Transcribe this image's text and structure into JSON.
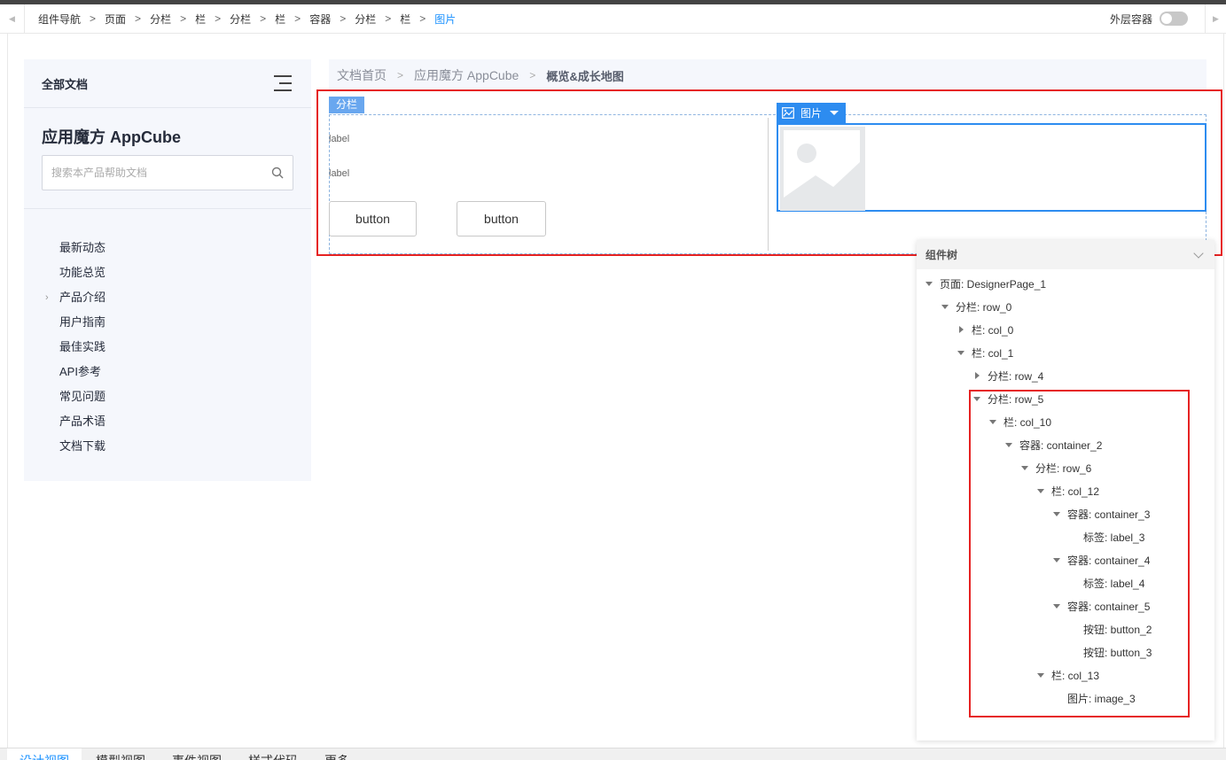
{
  "breadcrumb": {
    "items": [
      "组件导航",
      "页面",
      "分栏",
      "栏",
      "分栏",
      "栏",
      "容器",
      "分栏",
      "栏",
      "图片"
    ],
    "separator": ">"
  },
  "outer_container": {
    "label": "外层容器",
    "enabled": false
  },
  "doc_sidebar": {
    "header": "全部文档",
    "product_title": "应用魔方 AppCube",
    "search_placeholder": "搜索本产品帮助文档",
    "nav": [
      {
        "label": "最新动态",
        "expandable": false
      },
      {
        "label": "功能总览",
        "expandable": false
      },
      {
        "label": "产品介绍",
        "expandable": true
      },
      {
        "label": "用户指南",
        "expandable": false
      },
      {
        "label": "最佳实践",
        "expandable": false
      },
      {
        "label": "API参考",
        "expandable": false
      },
      {
        "label": "常见问题",
        "expandable": false
      },
      {
        "label": "产品术语",
        "expandable": false
      },
      {
        "label": "文档下载",
        "expandable": false
      }
    ]
  },
  "doc_breadcrumb": {
    "home": "文档首页",
    "product": "应用魔方 AppCube",
    "current": "概览&成长地图",
    "separator": ">"
  },
  "canvas": {
    "row_tag": "分栏",
    "label_1": "label",
    "label_2": "label",
    "button_1": "button",
    "button_2": "button",
    "image_tag": "图片"
  },
  "component_tree": {
    "title": "组件树",
    "nodes": [
      {
        "text": "页面: DesignerPage_1",
        "level": 0,
        "state": "expanded"
      },
      {
        "text": "分栏: row_0",
        "level": 1,
        "state": "expanded"
      },
      {
        "text": "栏: col_0",
        "level": 2,
        "state": "collapsed"
      },
      {
        "text": "栏: col_1",
        "level": 2,
        "state": "expanded"
      },
      {
        "text": "分栏: row_4",
        "level": 3,
        "state": "collapsed"
      },
      {
        "text": "分栏: row_5",
        "level": 3,
        "state": "expanded"
      },
      {
        "text": "栏: col_10",
        "level": 4,
        "state": "expanded"
      },
      {
        "text": "容器: container_2",
        "level": 5,
        "state": "expanded"
      },
      {
        "text": "分栏: row_6",
        "level": 6,
        "state": "expanded"
      },
      {
        "text": "栏: col_12",
        "level": 7,
        "state": "expanded"
      },
      {
        "text": "容器: container_3",
        "level": 8,
        "state": "expanded"
      },
      {
        "text": "标签: label_3",
        "level": 9,
        "state": "leaf"
      },
      {
        "text": "容器: container_4",
        "level": 8,
        "state": "expanded"
      },
      {
        "text": "标签: label_4",
        "level": 9,
        "state": "leaf"
      },
      {
        "text": "容器: container_5",
        "level": 8,
        "state": "expanded"
      },
      {
        "text": "按钮: button_2",
        "level": 9,
        "state": "leaf"
      },
      {
        "text": "按钮: button_3",
        "level": 9,
        "state": "leaf"
      },
      {
        "text": "栏: col_13",
        "level": 7,
        "state": "expanded"
      },
      {
        "text": "图片: image_3",
        "level": 8,
        "state": "leaf"
      }
    ]
  },
  "bottom_tabs": [
    {
      "label": "设计视图",
      "active": true
    },
    {
      "label": "模型视图",
      "active": false
    },
    {
      "label": "事件视图",
      "active": false
    },
    {
      "label": "样式代码",
      "active": false
    },
    {
      "label": "更多",
      "active": false
    }
  ],
  "colors": {
    "accent": "#1890ff",
    "highlight": "#e62222",
    "selection": "#2d8cf0"
  }
}
